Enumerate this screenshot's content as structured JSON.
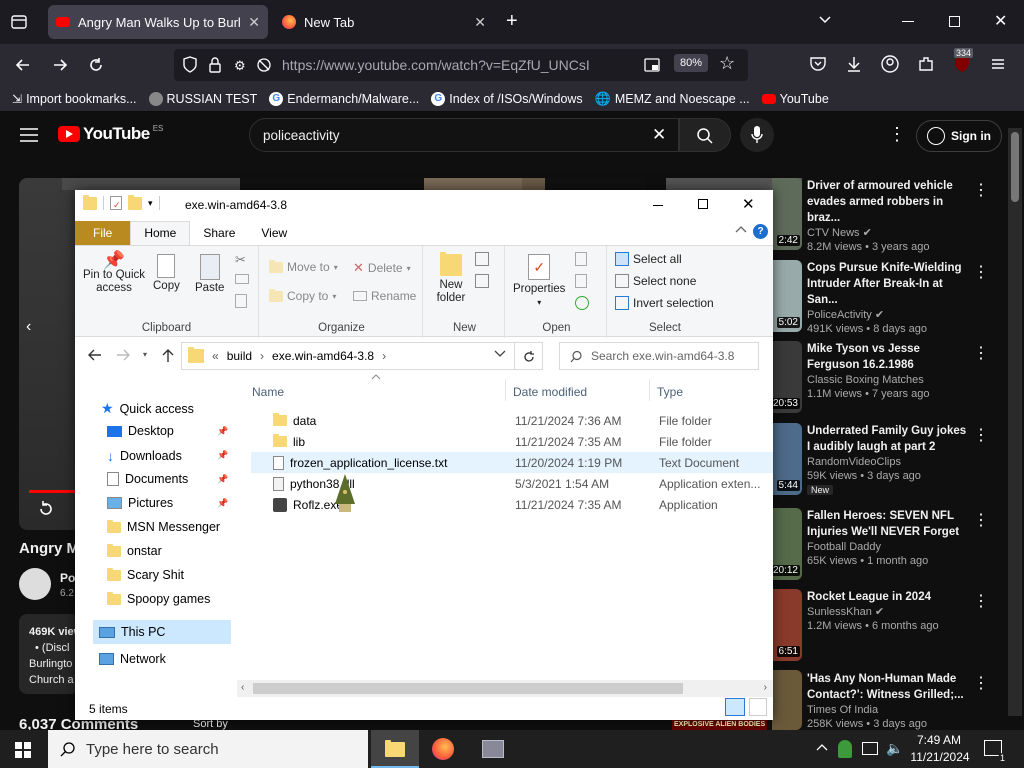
{
  "browser": {
    "tabs": [
      {
        "title": "Angry Man Walks Up to Burling"
      },
      {
        "title": "New Tab"
      }
    ],
    "url": "https://www.youtube.com/watch?v=EqZfU_UNCsI",
    "zoom": "80%",
    "extension_badge": "334",
    "bookmarks": [
      {
        "label": "Import bookmarks..."
      },
      {
        "label": "RUSSIAN TEST"
      },
      {
        "label": "Endermanch/Malware..."
      },
      {
        "label": "Index of /ISOs/Windows"
      },
      {
        "label": "MEMZ and Noescape ..."
      },
      {
        "label": "YouTube"
      }
    ]
  },
  "youtube": {
    "logo_text": "YouTube",
    "region": "ES",
    "search_value": "policeactivity",
    "sign_in": "Sign in",
    "video_title_partial": "Angry M",
    "channel_partial": "Po",
    "subs_partial": "6.2",
    "views_partial": "469K view",
    "desc_line1": "• (Discl",
    "desc_line2": "Burlingto",
    "desc_line3": "Church a",
    "comments": "6,037 Comments",
    "sort_by": "Sort by",
    "explosive_banner": "EXPLOSIVE ALIEN BODIES",
    "recommendations": [
      {
        "title": "Driver of armoured vehicle evades armed robbers in braz...",
        "channel": "CTV News",
        "meta": "8.2M views • 3 years ago",
        "duration": "2:42"
      },
      {
        "title": "Cops Pursue Knife-Wielding Intruder After Break-In at San...",
        "channel": "PoliceActivity",
        "meta": "491K views • 8 days ago",
        "duration": "5:02"
      },
      {
        "title": "Mike Tyson vs Jesse Ferguson 16.2.1986",
        "channel": "Classic Boxing Matches",
        "meta": "1.1M views • 7 years ago",
        "duration": "20:53"
      },
      {
        "title": "Underrated Family Guy jokes I audibly laugh at part 2",
        "channel": "RandomVideoClips",
        "meta": "59K views • 3 days ago",
        "duration": "5:44",
        "badge": "New"
      },
      {
        "title": "Fallen Heroes: SEVEN NFL Injuries We'll NEVER Forget",
        "channel": "Football Daddy",
        "meta": "65K views • 1 month ago",
        "duration": "20:12"
      },
      {
        "title": "Rocket League in 2024",
        "channel": "SunlessKhan",
        "meta": "1.2M views • 6 months ago",
        "duration": "6:51"
      },
      {
        "title": "'Has Any Non-Human Made Contact?': Witness Grilled;...",
        "channel": "Times Of India",
        "meta": "258K views • 3 days ago",
        "duration": ""
      }
    ]
  },
  "explorer": {
    "title": "exe.win-amd64-3.8",
    "ribbon_tabs": [
      "File",
      "Home",
      "Share",
      "View"
    ],
    "clipboard": {
      "pin": "Pin to Quick access",
      "copy": "Copy",
      "paste": "Paste",
      "label": "Clipboard"
    },
    "organize": {
      "move_to": "Move to",
      "copy_to": "Copy to",
      "delete": "Delete",
      "rename": "Rename",
      "label": "Organize"
    },
    "new": {
      "new_folder": "New folder",
      "label": "New"
    },
    "open": {
      "properties": "Properties",
      "label": "Open"
    },
    "select": {
      "select_all": "Select all",
      "select_none": "Select none",
      "invert": "Invert selection",
      "label": "Select"
    },
    "breadcrumb": [
      "build",
      "exe.win-amd64-3.8"
    ],
    "search_placeholder": "Search exe.win-amd64-3.8",
    "columns": {
      "name": "Name",
      "date": "Date modified",
      "type": "Type"
    },
    "nav": {
      "quick_access": "Quick access",
      "items": [
        "Desktop",
        "Downloads",
        "Documents",
        "Pictures",
        "MSN Messenger",
        "onstar",
        "Scary Shit",
        "Spoopy games"
      ],
      "this_pc": "This PC",
      "network": "Network"
    },
    "files": [
      {
        "name": "data",
        "date": "11/21/2024 7:36 AM",
        "type": "File folder"
      },
      {
        "name": "lib",
        "date": "11/21/2024 7:35 AM",
        "type": "File folder"
      },
      {
        "name": "frozen_application_license.txt",
        "date": "11/20/2024 1:19 PM",
        "type": "Text Document"
      },
      {
        "name": "python38.dll",
        "date": "5/3/2021 1:54 AM",
        "type": "Application exten..."
      },
      {
        "name": "Roflz.exe",
        "date": "11/21/2024 7:35 AM",
        "type": "Application"
      }
    ],
    "status": "5 items"
  },
  "taskbar": {
    "search_placeholder": "Type here to search",
    "time": "7:49 AM",
    "date": "11/21/2024",
    "notif_count": "1"
  }
}
